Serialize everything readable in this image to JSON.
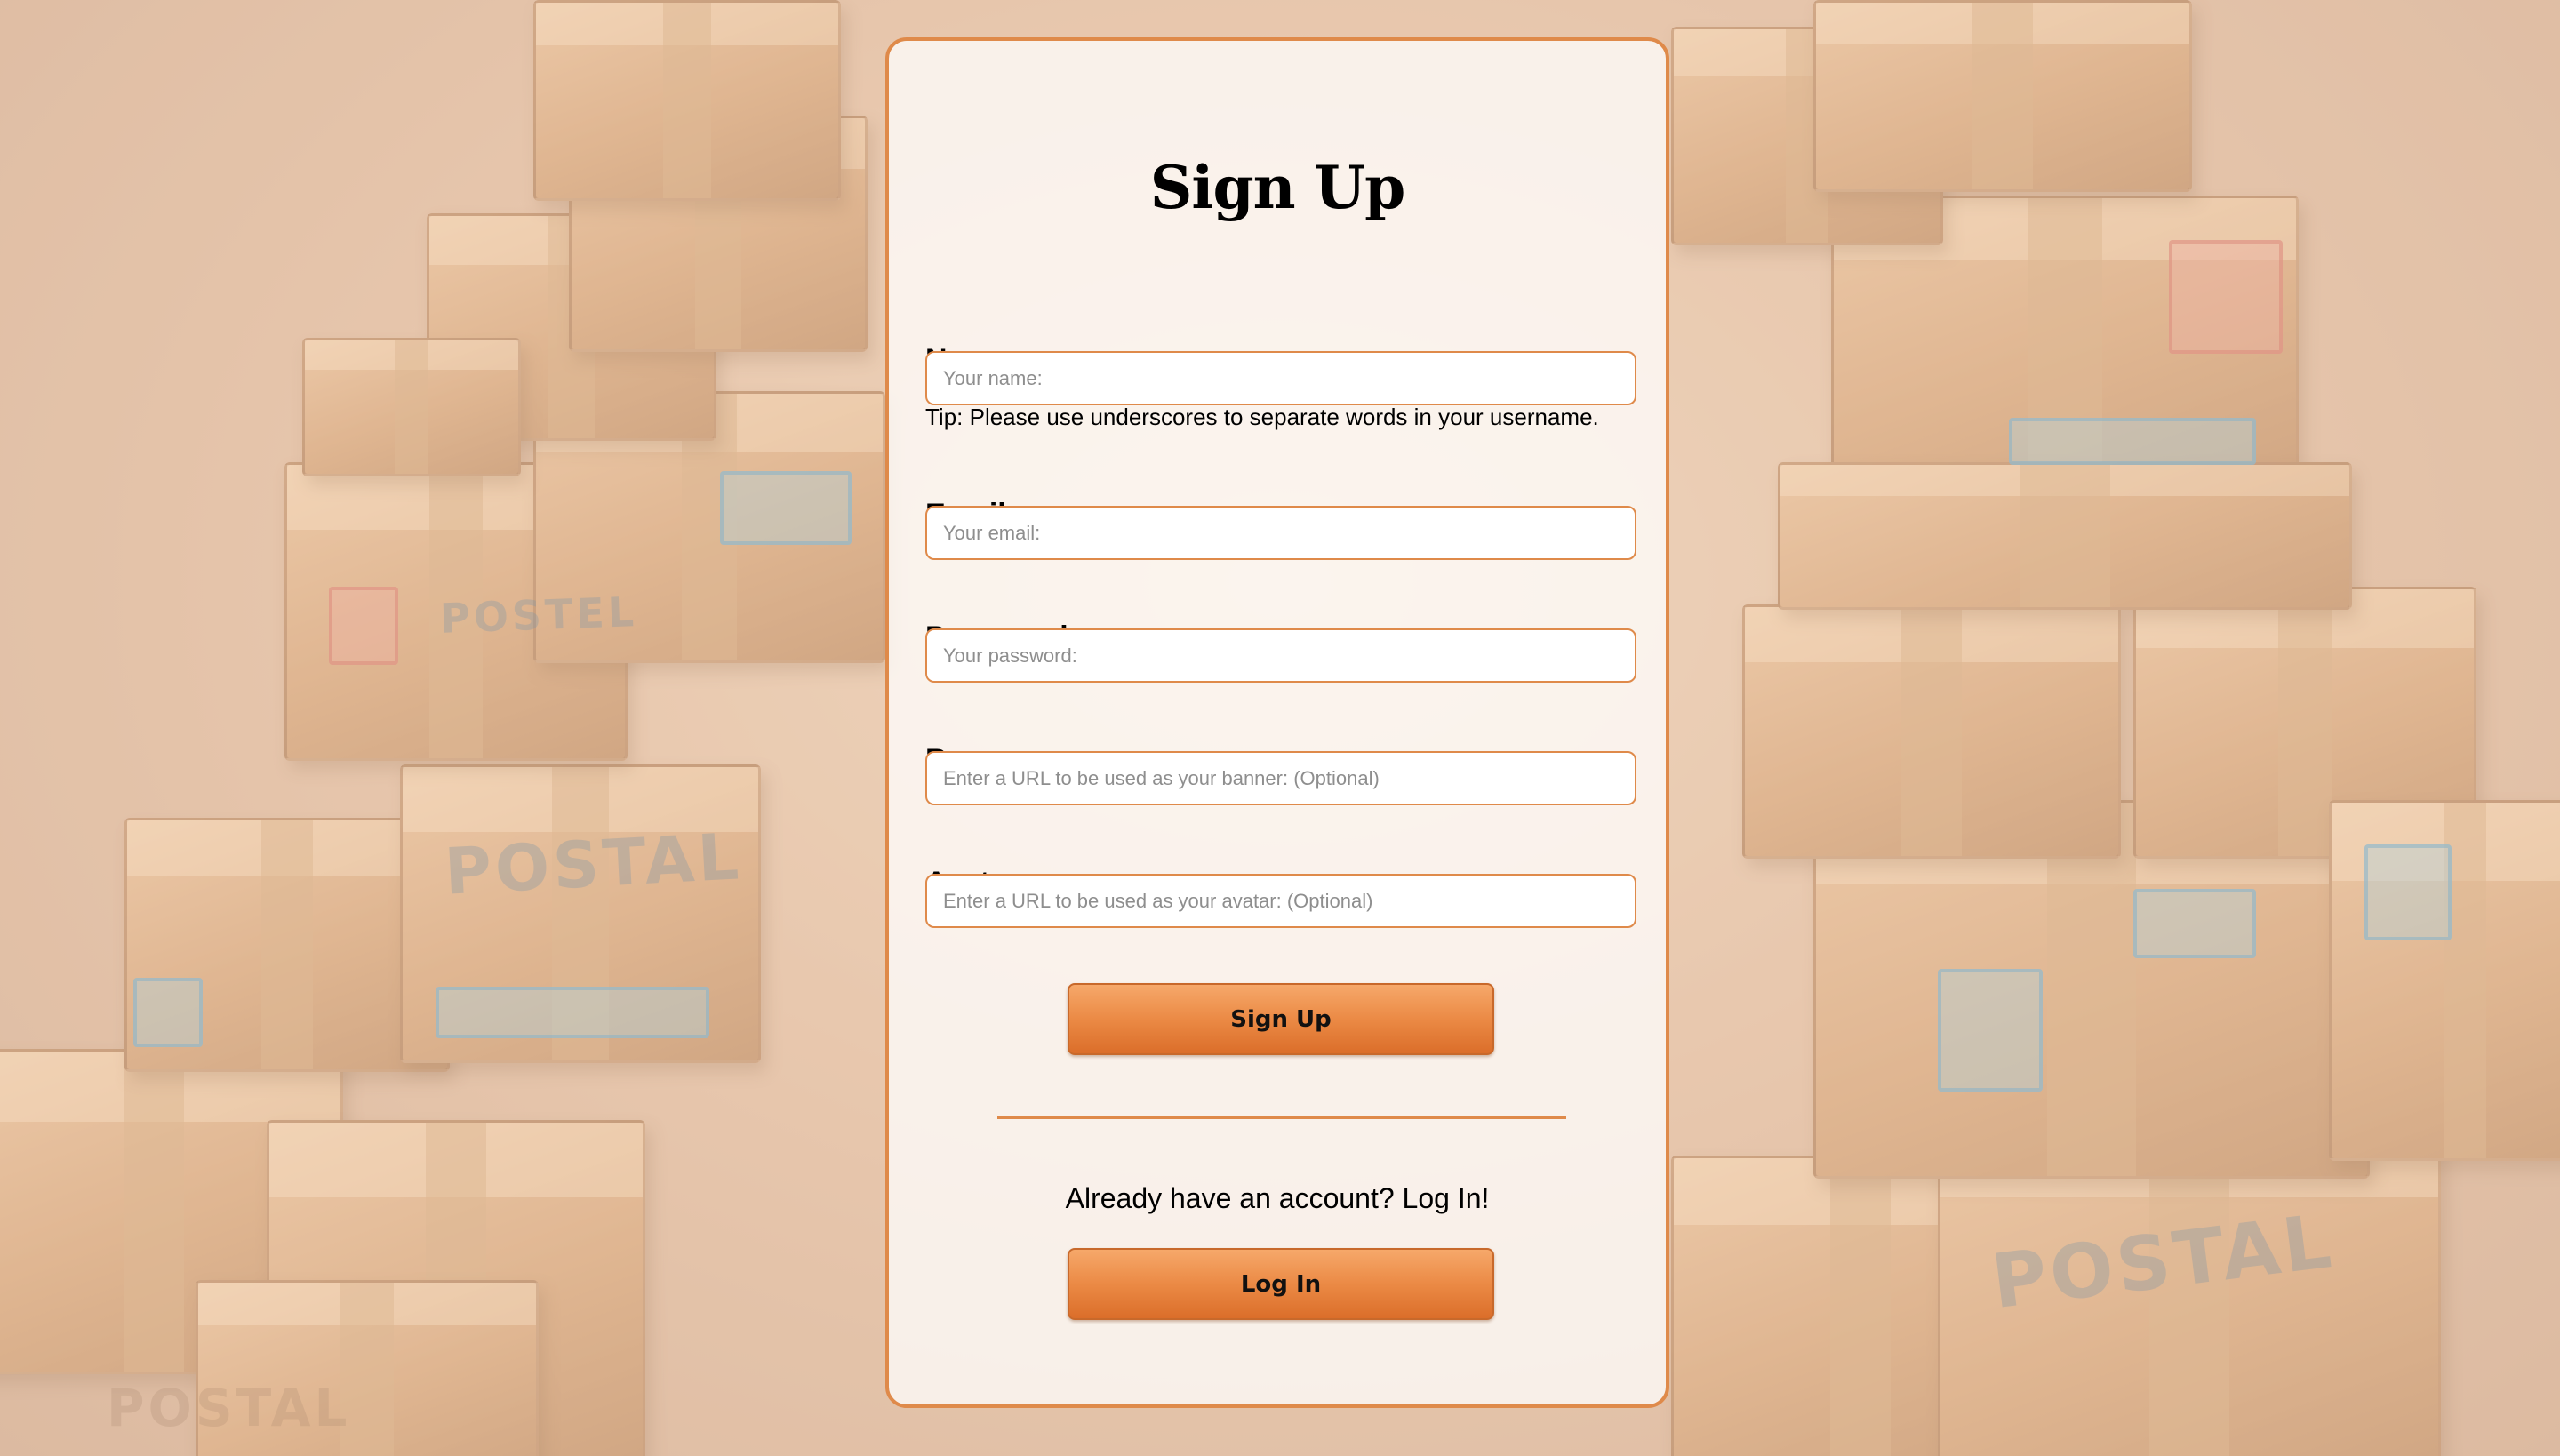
{
  "signup": {
    "title": "Sign Up",
    "name": {
      "label": "Name:",
      "placeholder": "Your name:",
      "tip": "Tip: Please use underscores to separate words in your username."
    },
    "email": {
      "label": "Email:",
      "placeholder": "Your email:"
    },
    "password": {
      "label": "Password:",
      "placeholder": "Your password:"
    },
    "banner": {
      "label": "Banner:",
      "placeholder": "Enter a URL to be used as your banner: (Optional)"
    },
    "avatar": {
      "label": "Avatar:",
      "placeholder": "Enter a URL to be used as your avatar: (Optional)"
    },
    "submit_label": "Sign Up",
    "login_prompt": "Already have an account? Log In!",
    "login_label": "Log In"
  },
  "theme": {
    "accent": "#df8a4a",
    "button_top": "#f6a86a",
    "button_bottom": "#db6e2a"
  },
  "background": {
    "image": "stack of cardboard postal boxes",
    "box_labels": [
      "POSTEL",
      "POSTAL",
      "POSTAL",
      "POSTAL"
    ]
  }
}
